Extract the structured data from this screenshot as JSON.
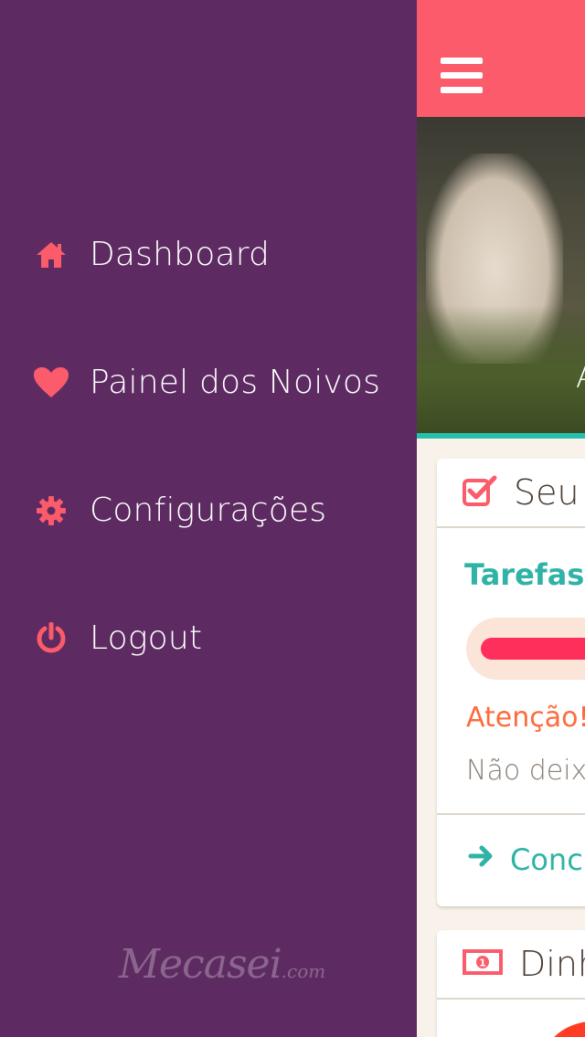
{
  "colors": {
    "drawer_bg": "#5d2b62",
    "accent_pink": "#fb5b6b",
    "teal": "#2fb3a7",
    "orange": "#ff6a3d",
    "progress_fill": "#ff2f5c"
  },
  "drawer": {
    "items": [
      {
        "label": "Dashboard",
        "icon": "home-icon"
      },
      {
        "label": "Painel dos Noivos",
        "icon": "heart-icon"
      },
      {
        "label": "Configurações",
        "icon": "gear-icon"
      },
      {
        "label": "Logout",
        "icon": "power-icon"
      }
    ],
    "logo": {
      "main": "Mecasei",
      "suffix": ".com"
    }
  },
  "topbar": {
    "menu_icon": "hamburger-icon"
  },
  "hero": {
    "caption": "A"
  },
  "card_tasks": {
    "icon": "checkbox-icon",
    "title": "Seu",
    "subtitle": "Tarefas c",
    "progress_fraction": 0.5,
    "warning_title": "Atenção!",
    "warning_text": "Não deixe",
    "link_icon": "arrow-right-icon",
    "link_label": "Concl"
  },
  "card_money": {
    "icon": "banknote-icon",
    "title": "Dinh"
  }
}
